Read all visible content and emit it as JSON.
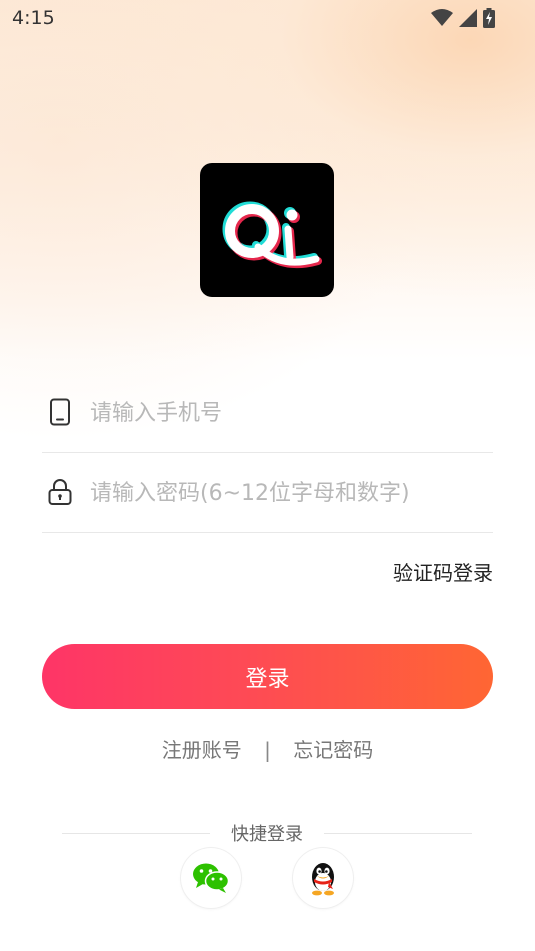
{
  "status_bar": {
    "time": "4:15"
  },
  "form": {
    "phone_placeholder": "请输入手机号",
    "password_placeholder": "请输入密码(6~12位字母和数字)",
    "code_login_label": "验证码登录",
    "login_button_label": "登录"
  },
  "links": {
    "register": "注册账号",
    "separator": "|",
    "forgot": "忘记密码"
  },
  "quick_login": {
    "title": "快捷登录",
    "options": [
      "wechat-icon",
      "qq-icon"
    ]
  },
  "colors": {
    "gradient_start": "#fe3567",
    "gradient_end": "#ff6633",
    "wechat": "#2dc100"
  }
}
